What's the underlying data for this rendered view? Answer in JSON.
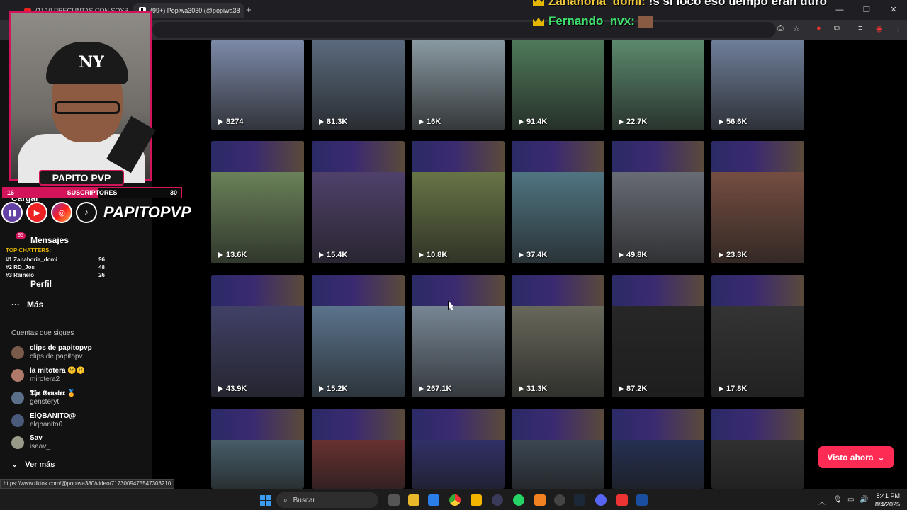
{
  "browser": {
    "tabs": [
      {
        "label": "(1) 10 PREGUNTAS CON SOYB"
      },
      {
        "label": "(99+) Popiwa3030 (@popiwa38"
      }
    ]
  },
  "overlay": {
    "chat_line_1": {
      "user": "Zanahoria_domi:",
      "message": "!s si loco eso tiempo eran duro"
    },
    "chat_line_2": {
      "user": "Fernando_nvx:"
    },
    "webcam_label": "PAPITO PVP",
    "subscriber_goal": {
      "current": "16",
      "label": "SUSCRIPTORES",
      "target": "30",
      "progress": 0.53
    },
    "social_handle": "PAPITOPVP",
    "top_chatters_title": "TOP CHATTERS:",
    "top_chatters": [
      {
        "rank": "#1 Zanahoria_domi",
        "count": "96"
      },
      {
        "rank": "#2 RD_Jos",
        "count": "48"
      },
      {
        "rank": "#3 Rainelo",
        "count": "26"
      }
    ]
  },
  "sidebar": {
    "upload_label": "Cargar",
    "messages_label": "Mensajes",
    "messages_badge": "95",
    "profile_label": "Perfil",
    "more_label": "Más",
    "following_header": "Cuentas que sigues",
    "following": [
      {
        "name": "clips de papitopvp",
        "handle": "clips.de.papitopv"
      },
      {
        "name": "la mitotera 🤫🤫",
        "handle": "mirotera2"
      },
      {
        "name": "𝕿𝖍𝖊 𝕲𝖊𝖓𝖘𝖙𝖊𝖗 🏅",
        "handle": "gensteryt"
      },
      {
        "name": "ElQBANITO@",
        "handle": "elqbanito0"
      },
      {
        "name": "Sav",
        "handle": "isaav_"
      }
    ],
    "see_more_label": "Ver más"
  },
  "videos": [
    [
      "8274",
      "81.3K",
      "16K",
      "91.4K",
      "22.7K",
      "56.6K"
    ],
    [
      "13.6K",
      "15.4K",
      "10.8K",
      "37.4K",
      "49.8K",
      "23.3K"
    ],
    [
      "43.9K",
      "15.2K",
      "267.1K",
      "31.3K",
      "87.2K",
      "17.8K"
    ],
    [
      "",
      "",
      "",
      "",
      "",
      ""
    ]
  ],
  "watched_button": "Visto ahora",
  "status_url": "https://www.tiktok.com/@popiwa380/video/7173009475547303210",
  "taskbar": {
    "search_placeholder": "Buscar",
    "time": "8:41 PM",
    "date": "8/4/2025"
  },
  "colors": {
    "accent": "#fe2c55",
    "overlay_pink": "#d4145a",
    "background": "#000000"
  }
}
